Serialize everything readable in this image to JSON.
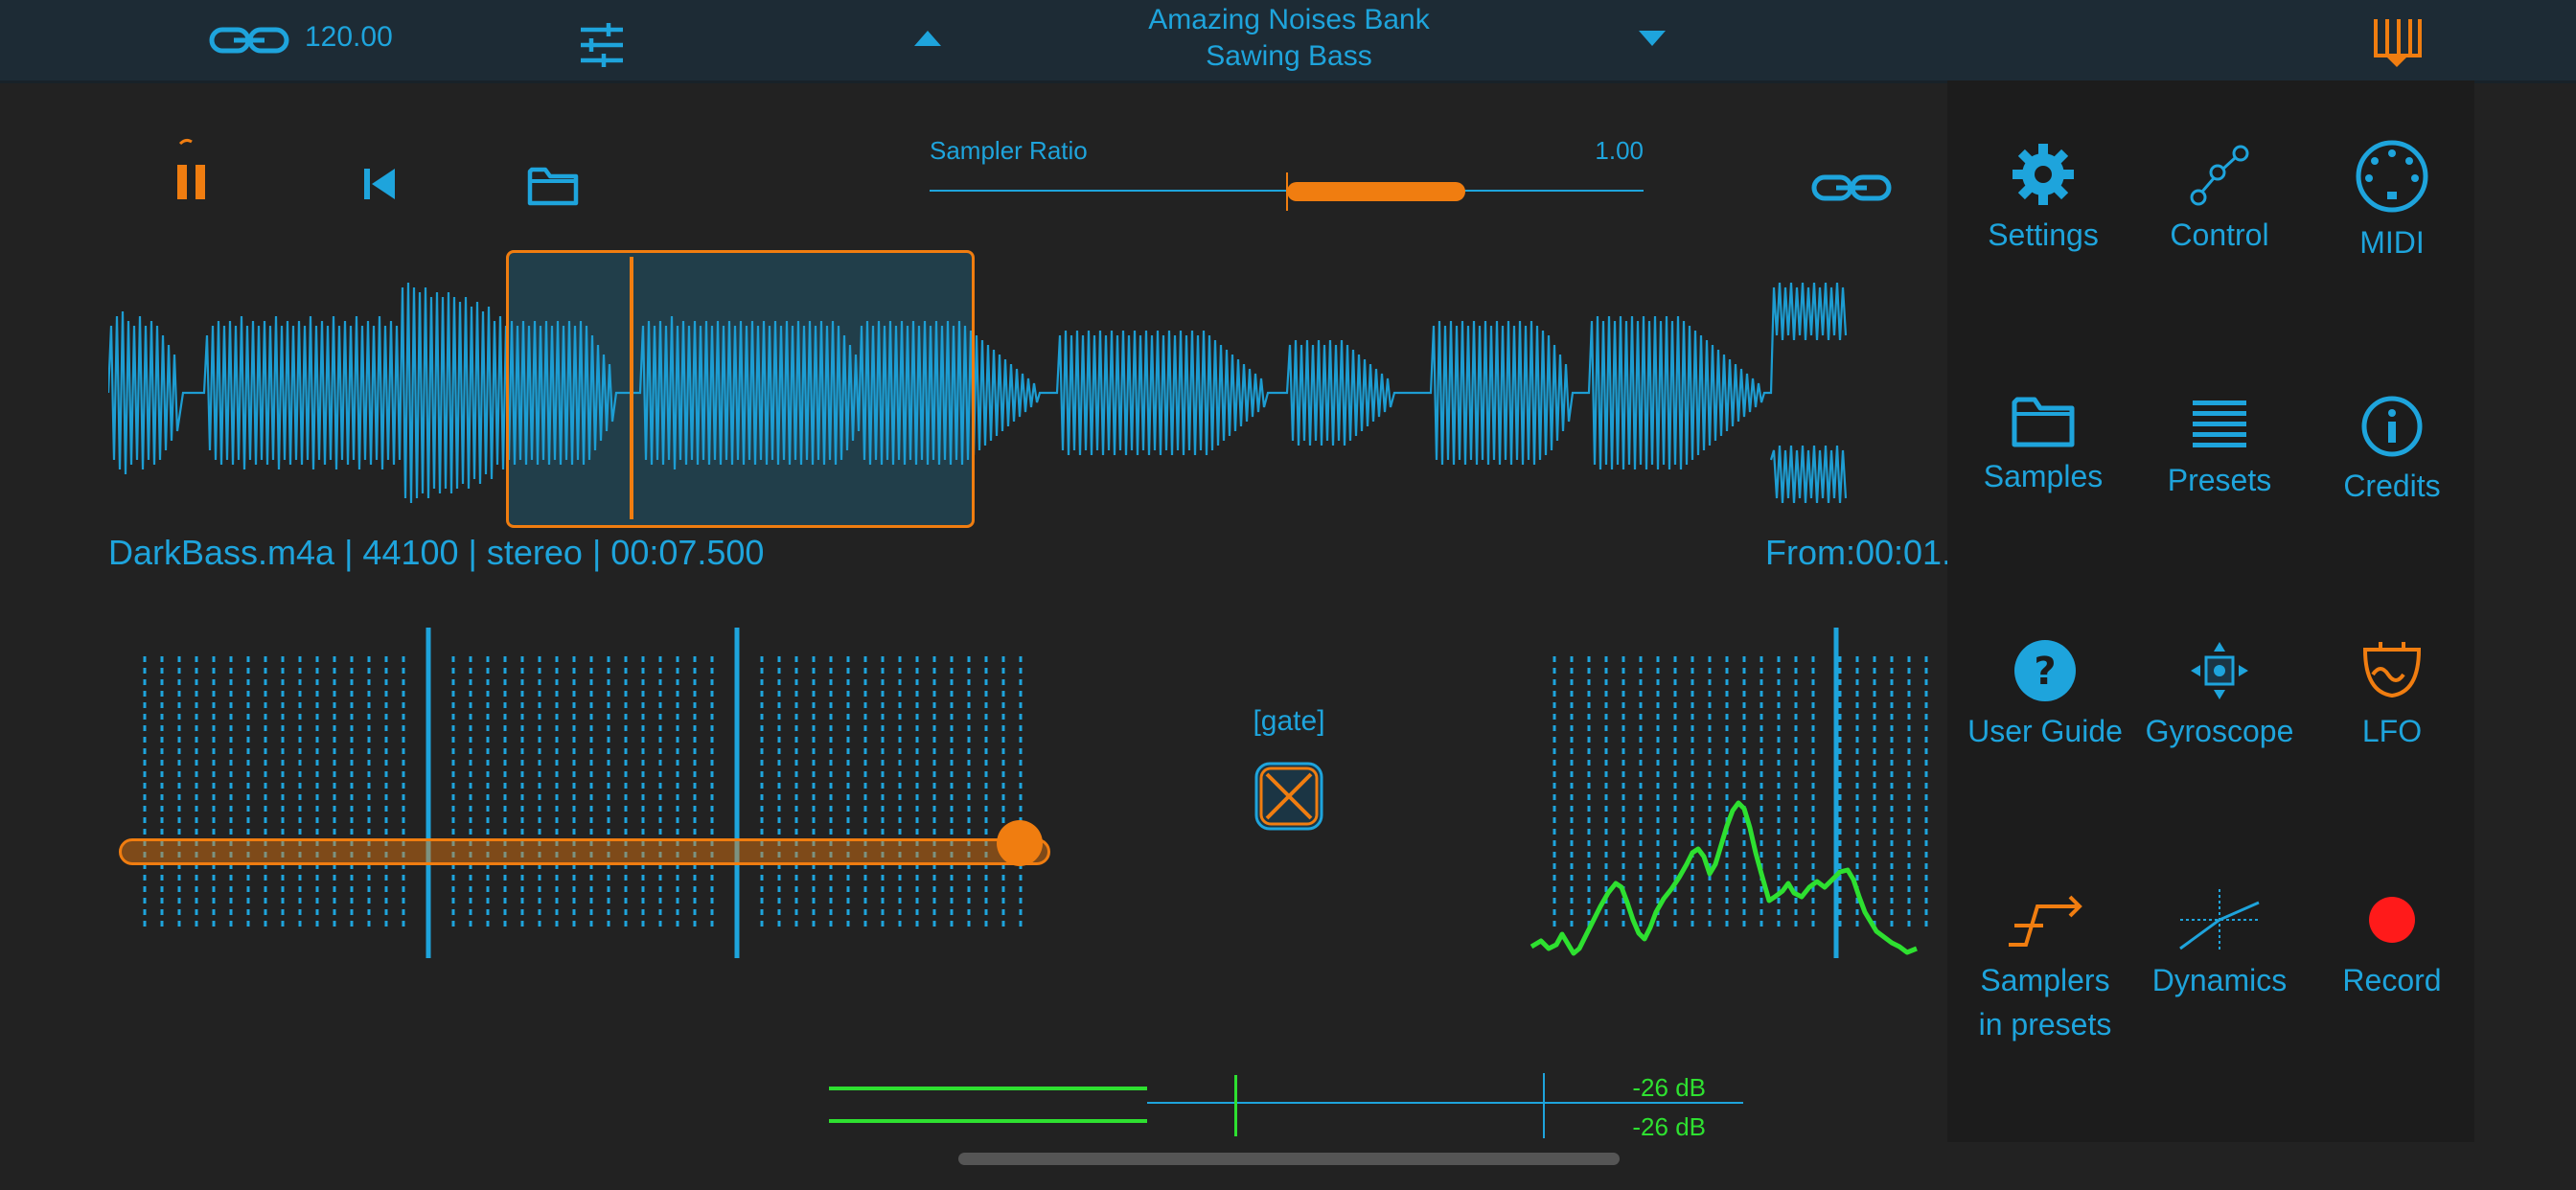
{
  "topbar": {
    "bpm": "120.00",
    "preset_bank": "Amazing Noises Bank",
    "preset_name": "Sawing Bass"
  },
  "sampler": {
    "ratio_label": "Sampler Ratio",
    "ratio_value": "1.00"
  },
  "file_info": {
    "text": "DarkBass.m4a | 44100 | stereo  | 00:07.500",
    "from": "From:00:01."
  },
  "gate": {
    "label": "[gate]"
  },
  "meters": {
    "left_db": "-26 dB",
    "right_db": "-26 dB"
  },
  "colors": {
    "accent_blue": "#1ea4dc",
    "accent_orange": "#f07d10",
    "meter_green": "#2ee030",
    "record_red": "#ff1a1a",
    "background": "#222222"
  },
  "menu": {
    "items": [
      {
        "label": "Settings",
        "icon": "gear-icon"
      },
      {
        "label": "Control",
        "icon": "control-nodes-icon"
      },
      {
        "label": "MIDI",
        "icon": "midi-icon"
      },
      {
        "label": "Samples",
        "icon": "folder-icon"
      },
      {
        "label": "Presets",
        "icon": "list-icon"
      },
      {
        "label": "Credits",
        "icon": "info-icon"
      },
      {
        "label": "User Guide",
        "icon": "help-icon"
      },
      {
        "label": "Gyroscope",
        "icon": "gyroscope-icon"
      },
      {
        "label": "LFO",
        "icon": "lfo-icon"
      },
      {
        "label": "Samplers",
        "label2": "in presets",
        "icon": "samplers-icon"
      },
      {
        "label": "Dynamics",
        "icon": "dynamics-icon"
      },
      {
        "label": "Record",
        "icon": "record-icon"
      }
    ]
  }
}
